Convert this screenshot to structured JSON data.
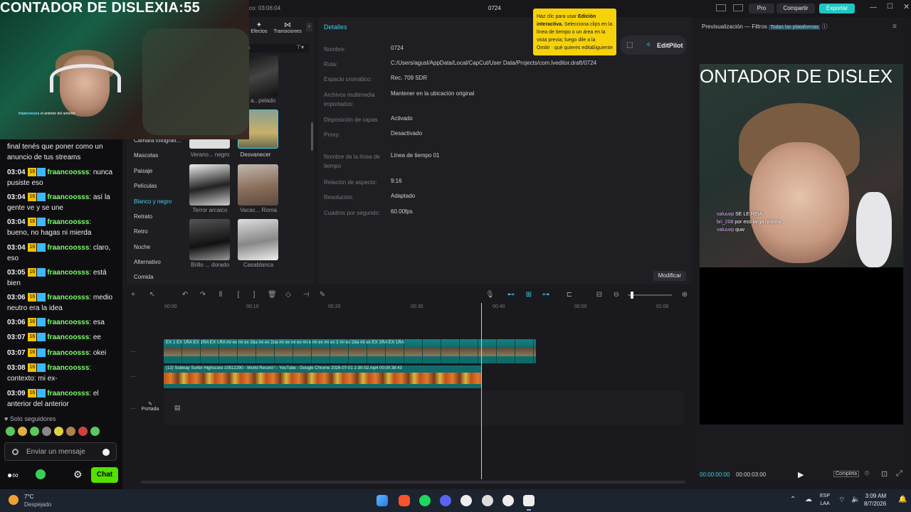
{
  "webcam": {
    "title": "CONTADOR DE DISLEXIA:55",
    "overlay_user": "fraancoosss",
    "overlay_text": "el anterior del anterior"
  },
  "chat": {
    "continuation": "final tenés que poner como un anuncio de tus streams",
    "messages": [
      {
        "time": "03:04",
        "badge": "16",
        "user": "fraancoosss",
        "text": "nunca pusiste eso"
      },
      {
        "time": "03:04",
        "badge": "16",
        "user": "fraancoosss",
        "text": "así la gente ve y se une"
      },
      {
        "time": "03:04",
        "badge": "16",
        "user": "fraancoosss",
        "text": "bueno, no hagas ni mierda"
      },
      {
        "time": "03:04",
        "badge": "16",
        "user": "fraancoosss",
        "text": "claro, eso"
      },
      {
        "time": "03:05",
        "badge": "16",
        "user": "fraancoosss",
        "text": "está bien"
      },
      {
        "time": "03:06",
        "badge": "16",
        "user": "fraancoosss",
        "text": "medio neutro era la idea"
      },
      {
        "time": "03:06",
        "badge": "16",
        "user": "fraancoosss",
        "text": "esa"
      },
      {
        "time": "03:07",
        "badge": "16",
        "user": "fraancoosss",
        "text": "ee"
      },
      {
        "time": "03:07",
        "badge": "16",
        "user": "fraancoosss",
        "text": "okei"
      },
      {
        "time": "03:08",
        "badge": "16",
        "user": "fraancoosss",
        "text": "contexto: mi ex-"
      },
      {
        "time": "03:09",
        "badge": "16",
        "user": "fraancoosss",
        "text": "el anterior del anterior"
      }
    ],
    "followers_only": "Solo seguidores",
    "input_placeholder": "Enviar un mensaje",
    "chat_button": "Chat"
  },
  "titlebar": {
    "left_text": "co: 03:06:04",
    "center_title": "0724",
    "pro_label": "Pro",
    "share_label": "Compartir",
    "export_label": "Exportar"
  },
  "media_panel": {
    "tabs": [
      "Efectos",
      "Transiciones"
    ],
    "search_fragment": "ia",
    "categories": [
      "Cámara fotográfi...",
      "Mascotas",
      "Paisaje",
      "Películas",
      "Blanco y negro",
      "Retrato",
      "Retro",
      "Noche",
      "Alternativo",
      "Comida"
    ],
    "active_category": "Blanco y negro",
    "thumbnails": [
      {
        "label": "...e a...pelado"
      },
      {
        "label": "Verano... negro"
      },
      {
        "label": "Desvanecer"
      },
      {
        "label": "Terror arcaico"
      },
      {
        "label": "Vacac... Roma"
      },
      {
        "label": "Brillo ... dorado"
      },
      {
        "label": "Casablanca"
      }
    ]
  },
  "details": {
    "title": "Detalles",
    "rows": [
      {
        "label": "Nombre:",
        "value": "0724"
      },
      {
        "label": "Ruta:",
        "value": "C:/Users/agusl/AppData/Local/CapCut/User Data/Projects/com.lveditor.draft/0724"
      },
      {
        "label": "Espacio cromático:",
        "value": "Rec. 709 SDR"
      },
      {
        "label": "Archivos multimedia importados:",
        "value": "Mantener en la ubicación original"
      },
      {
        "label": "Disposición de capas",
        "value": "Activado"
      },
      {
        "label": "Proxy:",
        "value": "Desactivado"
      },
      {
        "label": "Nombre de la línea de tiempo",
        "value": "Línea de tiempo 01"
      },
      {
        "label": "Relación de aspecto:",
        "value": "9:16"
      },
      {
        "label": "Resolución:",
        "value": "Adaptado"
      },
      {
        "label": "Cuadros por segundo:",
        "value": "60.00fps"
      }
    ],
    "modify_button": "Modificar"
  },
  "tooltip": {
    "text_before": "Haz clic para usar ",
    "bold": "Edición interactiva.",
    "text_after": " Selecciona clips en la línea de tiempo o un área en la vista previa; luego dile a la",
    "last_line": "Omitir · qué quieres edita",
    "next": "Siguiente"
  },
  "editpilot": {
    "label": "EditPilot"
  },
  "preview": {
    "title": "Previsualización — Filtros",
    "platforms": "Todas las plataformas",
    "image_title": "ONTADOR DE DISLEX",
    "overlay_chat": [
      {
        "user": "valuuvp",
        "text": "SE LE REIA"
      },
      {
        "user": "bri_208",
        "text": "por eso   larga historia"
      },
      {
        "user": "valuuvp",
        "text": "quw"
      }
    ],
    "time_current": "00:00:00:00",
    "time_total": "00:00:03:00",
    "complete_label": "Completa"
  },
  "timeline": {
    "ruler": [
      "00:00",
      "00:10",
      "00:20",
      "00:30",
      "00:40",
      "00:50",
      "01:00"
    ],
    "track1_label": "EX 1  EX 1RA  EX 1RA  EX 1RA mi ex  mi ex 2da mi ex 2da mi ex  mi ex  mi e      mi ex  mi ex 2  mi ex 2da mi ex  EX 1RA  EX 1RA",
    "track2_label": "(12) Subway Surfer Highscore 10512290 - World Record ! - YouTube - Google Chrome 2026-07-01 2-30-02.mp4   00:00:38:43",
    "cover_label": "Portada"
  },
  "taskbar": {
    "temperature": "7°C",
    "weather": "Despejado",
    "lang_top": "ESP",
    "lang_bottom": "LAA",
    "time": "3:09 AM",
    "date": "8/7/2026"
  }
}
